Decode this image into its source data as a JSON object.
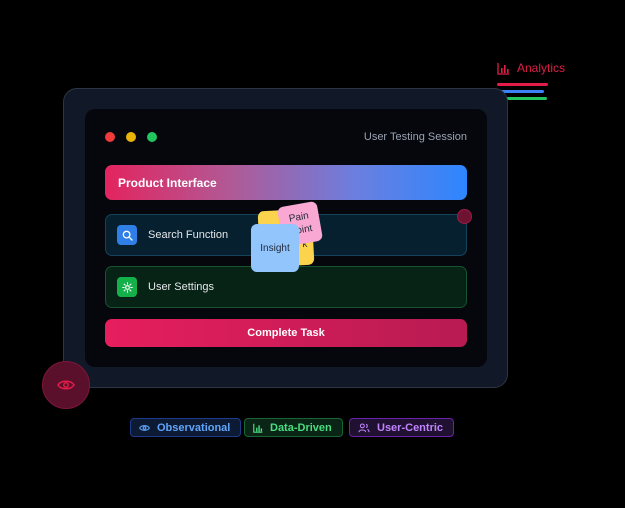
{
  "window": {
    "title": "User Testing Session"
  },
  "product": {
    "label": "Product Interface"
  },
  "rows": {
    "search": {
      "label": "Search Function",
      "icon": "search-icon"
    },
    "settings": {
      "label": "User Settings",
      "icon": "gear-icon"
    }
  },
  "actions": {
    "complete_label": "Complete Task"
  },
  "sticky_notes": {
    "pain": "Pain Point",
    "insight": "Insight",
    "hidden_fragment": "k"
  },
  "analytics": {
    "label": "Analytics",
    "icon": "bar-chart-icon",
    "bar_colors": [
      "#e11d48",
      "#3b82f6",
      "#22c55e"
    ]
  },
  "tags": {
    "observational": "Observational",
    "data_driven": "Data-Driven",
    "user_centric": "User-Centric"
  },
  "colors": {
    "accent_red": "#e11d48",
    "accent_blue": "#2d86ff",
    "accent_green": "#22c55e"
  }
}
